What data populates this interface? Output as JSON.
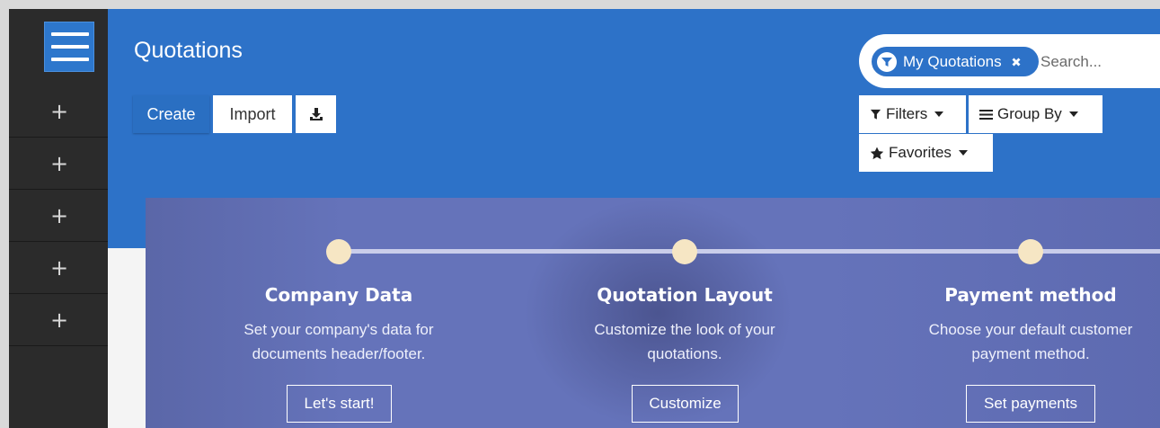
{
  "sidebar": {
    "items": [
      {
        "icon": "plus-icon",
        "glyph": "+"
      },
      {
        "icon": "plus-icon",
        "glyph": "+"
      },
      {
        "icon": "plus-icon",
        "glyph": "+"
      },
      {
        "icon": "plus-icon",
        "glyph": "+"
      },
      {
        "icon": "plus-icon",
        "glyph": "+"
      }
    ]
  },
  "header": {
    "title": "Quotations",
    "create_label": "Create",
    "import_label": "Import"
  },
  "search": {
    "facet_label": "My Quotations",
    "placeholder": "Search..."
  },
  "filters": {
    "filters_label": "Filters",
    "group_by_label": "Group By",
    "favorites_label": "Favorites"
  },
  "onboarding": {
    "steps": [
      {
        "title": "Company Data",
        "description": [
          "Set your company's data for",
          "documents header/footer."
        ],
        "button": "Let's start!"
      },
      {
        "title": "Quotation Layout",
        "description": [
          "Customize the look of your",
          "quotations."
        ],
        "button": "Customize"
      },
      {
        "title": "Payment method",
        "description": [
          "Choose your default customer",
          "payment method."
        ],
        "button": "Set payments"
      }
    ]
  },
  "colors": {
    "header_blue": "#2d72c8",
    "sidebar_dark": "#2b2b2b",
    "banner": "#6573ba",
    "step_dot": "#f6e6c4"
  }
}
